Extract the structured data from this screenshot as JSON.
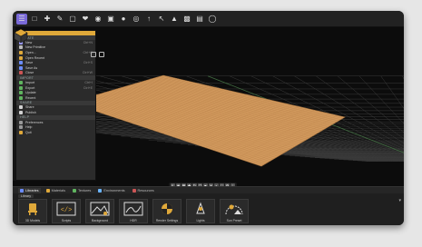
{
  "menu": {
    "title": "",
    "sections": [
      {
        "label": "CREATE",
        "items": [
          {
            "label": "New",
            "shortcut": "Ctrl+N",
            "icon": "file-icon",
            "color": "#9c9cff"
          },
          {
            "label": "New Primitive",
            "shortcut": "",
            "icon": "cube-icon",
            "color": "#bbbbbb"
          },
          {
            "label": "Open...",
            "shortcut": "Ctrl+O",
            "icon": "folder-icon",
            "color": "#e0a93a"
          },
          {
            "label": "Open Recent",
            "shortcut": "",
            "icon": "folder-clock-icon",
            "color": "#e0a93a"
          },
          {
            "label": "Save",
            "shortcut": "Ctrl+S",
            "icon": "save-icon",
            "color": "#6b8cff"
          },
          {
            "label": "Save As",
            "shortcut": "",
            "icon": "save-as-icon",
            "color": "#6b8cff"
          },
          {
            "label": "Close",
            "shortcut": "Ctrl+W",
            "icon": "close-file-icon",
            "color": "#cc5555"
          }
        ]
      },
      {
        "label": "IMPORT",
        "items": [
          {
            "label": "Import",
            "shortcut": "Ctrl+I",
            "icon": "import-icon",
            "color": "#5fb55f"
          },
          {
            "label": "Export",
            "shortcut": "Ctrl+E",
            "icon": "export-icon",
            "color": "#5fb55f"
          },
          {
            "label": "Update",
            "shortcut": "",
            "icon": "update-icon",
            "color": "#5fb55f"
          },
          {
            "label": "Recent",
            "shortcut": "",
            "icon": "recent-icon",
            "color": "#5fb55f"
          }
        ]
      },
      {
        "label": "SHARE",
        "items": [
          {
            "label": "Share",
            "shortcut": "",
            "icon": "share-icon",
            "color": "#d2d2d2"
          },
          {
            "label": "Publish",
            "shortcut": "",
            "icon": "publish-icon",
            "color": "#d2d2d2"
          }
        ]
      },
      {
        "label": "HELP",
        "items": [
          {
            "label": "Preferences",
            "shortcut": "",
            "icon": "gear-icon",
            "color": "#999999"
          },
          {
            "label": "Help",
            "shortcut": "",
            "icon": "help-icon",
            "color": "#999999"
          }
        ]
      },
      {
        "label": "",
        "items": [
          {
            "label": "Quit",
            "shortcut": "",
            "icon": "quit-icon",
            "color": "#e0a93a"
          }
        ]
      }
    ]
  },
  "tabs": [
    {
      "label": "Libraries",
      "icon": "library-icon",
      "color": "#6b8cff",
      "active": true
    },
    {
      "label": "Materials",
      "icon": "material-icon",
      "color": "#e0a93a",
      "active": false
    },
    {
      "label": "Textures",
      "icon": "texture-icon",
      "color": "#5fb55f",
      "active": false
    },
    {
      "label": "Environments",
      "icon": "environment-icon",
      "color": "#6bb5ff",
      "active": false
    },
    {
      "label": "Resources",
      "icon": "resource-icon",
      "color": "#cc5555",
      "active": false
    }
  ],
  "breadcrumb": "Library",
  "library_items": [
    {
      "label": "3D Models",
      "icon": "chair-icon"
    },
    {
      "label": "Scripts",
      "icon": "code-icon"
    },
    {
      "label": "Background",
      "icon": "landscape-icon"
    },
    {
      "label": "HDR",
      "icon": "hdr-icon"
    },
    {
      "label": "Render Settings",
      "icon": "render-icon"
    },
    {
      "label": "Lights",
      "icon": "light-icon"
    },
    {
      "label": "Sun Preset",
      "icon": "sun-icon"
    }
  ],
  "colors": {
    "accent": "#7a6ad8",
    "menu_header": "#e0a93a",
    "floor": "#d29a5e",
    "grid": "#3a3a3a"
  }
}
